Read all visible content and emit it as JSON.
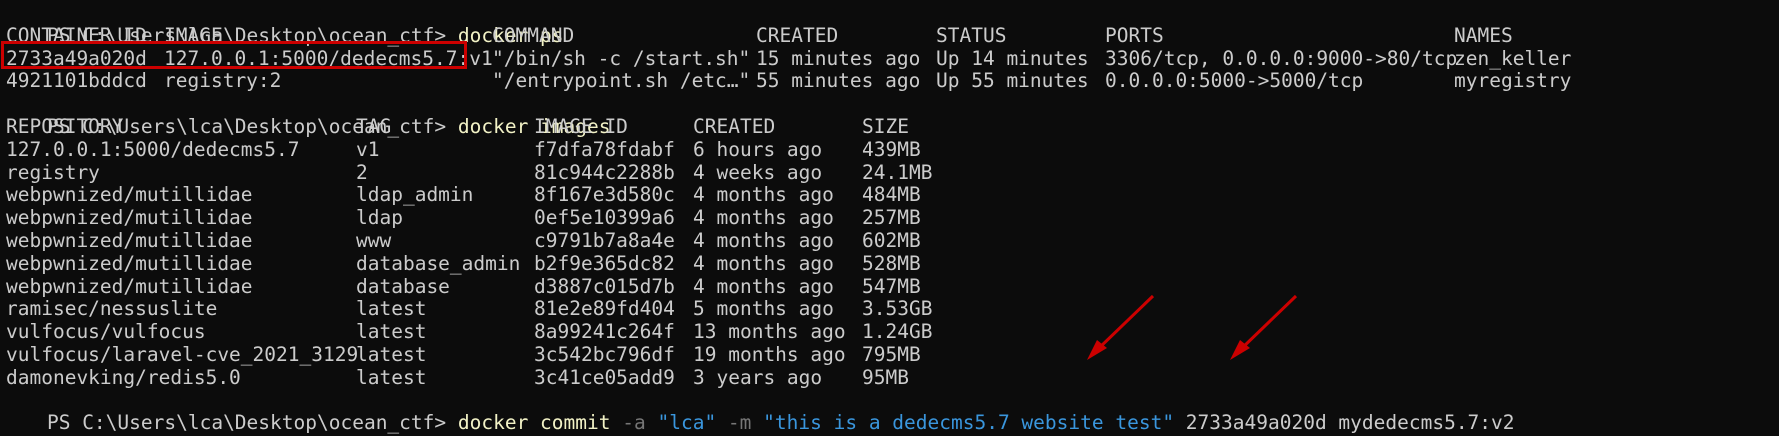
{
  "terminal": {
    "prompt1": "PS C:\\Users\\lca\\Desktop\\ocean_ctf> ",
    "cmd1": "docker ps",
    "ps_headers": [
      "CONTAINER ID",
      "IMAGE",
      "COMMAND",
      "CREATED",
      "STATUS",
      "PORTS",
      "NAMES"
    ],
    "ps_rows": [
      [
        "2733a49a020d",
        "127.0.0.1:5000/dedecms5.7:v1",
        "\"/bin/sh -c /start.sh\"",
        "15 minutes ago",
        "Up 14 minutes",
        "3306/tcp, 0.0.0.0:9000->80/tcp",
        "zen_keller"
      ],
      [
        "4921101bddcd",
        "registry:2",
        "\"/entrypoint.sh /etc…\"",
        "55 minutes ago",
        "Up 55 minutes",
        "0.0.0.0:5000->5000/tcp",
        "myregistry"
      ]
    ],
    "prompt2": "PS C:\\Users\\lca\\Desktop\\ocean_ctf> ",
    "cmd2": "docker images",
    "img_headers": [
      "REPOSITORY",
      "TAG",
      "IMAGE ID",
      "CREATED",
      "SIZE"
    ],
    "img_rows": [
      [
        "127.0.0.1:5000/dedecms5.7",
        "v1",
        "f7dfa78fdabf",
        "6 hours ago",
        "439MB"
      ],
      [
        "registry",
        "2",
        "81c944c2288b",
        "4 weeks ago",
        "24.1MB"
      ],
      [
        "webpwnized/mutillidae",
        "ldap_admin",
        "8f167e3d580c",
        "4 months ago",
        "484MB"
      ],
      [
        "webpwnized/mutillidae",
        "ldap",
        "0ef5e10399a6",
        "4 months ago",
        "257MB"
      ],
      [
        "webpwnized/mutillidae",
        "www",
        "c9791b7a8a4e",
        "4 months ago",
        "602MB"
      ],
      [
        "webpwnized/mutillidae",
        "database_admin",
        "b2f9e365dc82",
        "4 months ago",
        "528MB"
      ],
      [
        "webpwnized/mutillidae",
        "database",
        "d3887c015d7b",
        "4 months ago",
        "547MB"
      ],
      [
        "ramisec/nessuslite",
        "latest",
        "81e2e89fd404",
        "5 months ago",
        "3.53GB"
      ],
      [
        "vulfocus/vulfocus",
        "latest",
        "8a99241c264f",
        "13 months ago",
        "1.24GB"
      ],
      [
        "vulfocus/laravel-cve_2021_3129",
        "latest",
        "3c542bc796df",
        "19 months ago",
        "795MB"
      ],
      [
        "damonevking/redis5.0",
        "latest",
        "3c41ce05add9",
        "3 years ago",
        "95MB"
      ]
    ],
    "prompt3": "PS C:\\Users\\lca\\Desktop\\ocean_ctf> ",
    "cmd3": {
      "base": "docker commit ",
      "flag_a": "-a ",
      "val_a": "\"lca\"",
      "flag_m": " -m ",
      "val_m": "\"this is a dedecms5.7 website test\"",
      "rest": " 2733a49a020d mydedecms5.7:v2"
    }
  },
  "colors": {
    "background": "#0c0c0c",
    "text": "#cccccc",
    "command": "#f2f2c6",
    "flag": "#767676",
    "string": "#3a96dd",
    "annotation": "#cc0000"
  }
}
